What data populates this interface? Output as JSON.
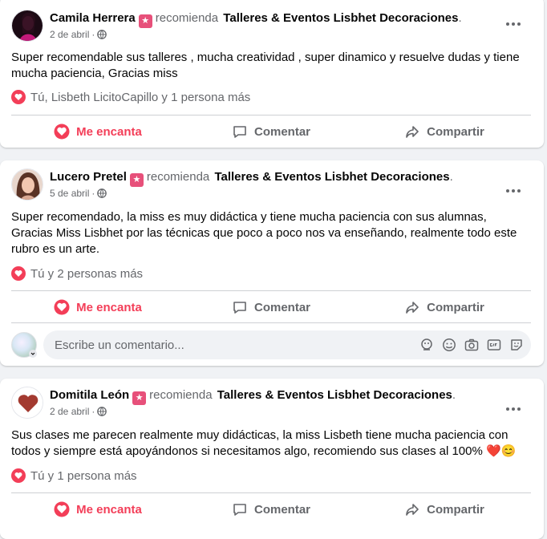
{
  "posts": [
    {
      "author": "Camila Herrera",
      "verb": "recomienda",
      "page": "Talleres & Eventos Lisbhet Decoraciones",
      "date": "2 de abril",
      "text": "Super recomendable sus talleres , mucha creatividad , super dinamico y resuelve dudas y tiene mucha paciencia, Gracias miss",
      "reactions": "Tú, Lisbeth LicitoCapillo y 1 persona más"
    },
    {
      "author": "Lucero Pretel",
      "verb": "recomienda",
      "page": "Talleres & Eventos Lisbhet Decoraciones",
      "date": "5 de abril",
      "text": "Super recomendado, la miss es muy didáctica y tiene mucha paciencia con sus alumnas, Gracias Miss Lisbhet por las técnicas que poco a poco nos va enseñando, realmente todo este rubro es un arte.",
      "reactions": "Tú y 2 personas más"
    },
    {
      "author": "Domitila León",
      "verb": "recomienda",
      "page": "Talleres & Eventos Lisbhet Decoraciones",
      "date": "2 de abril",
      "text": "Sus clases me parecen realmente muy didácticas, la miss Lisbeth tiene mucha paciencia con todos y siempre está apoyándonos si necesitamos algo, recomiendo sus  clases al 100% ❤️😊",
      "reactions": "Tú y 1 persona más"
    }
  ],
  "actions": {
    "like": "Me encanta",
    "comment": "Comentar",
    "share": "Compartir"
  },
  "comment_box": {
    "placeholder": "Escribe un comentario..."
  },
  "colors": {
    "love": "#f33e58",
    "badge": "#e7507a",
    "secondary_text": "#65676b",
    "background": "#f0f2f5"
  }
}
